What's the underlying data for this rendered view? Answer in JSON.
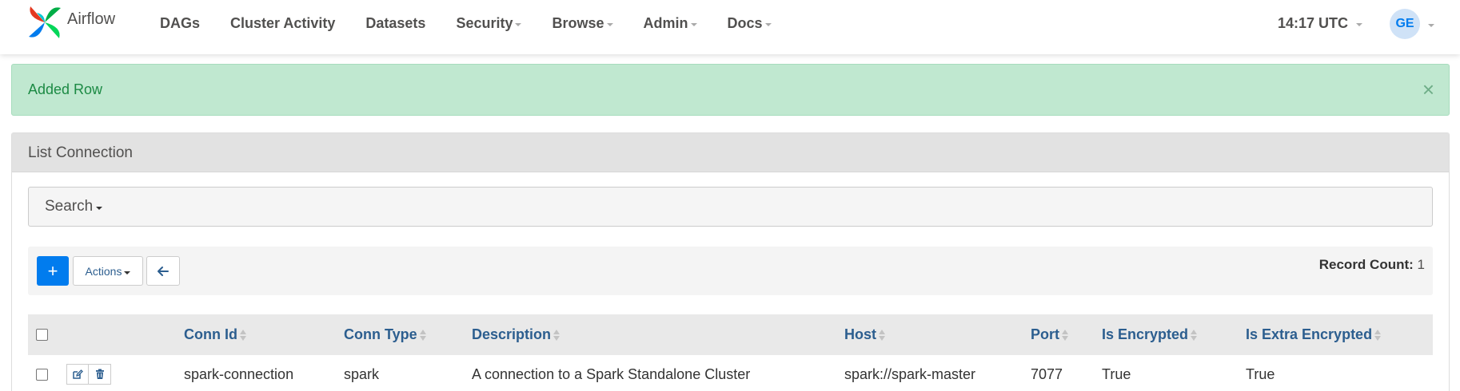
{
  "navbar": {
    "brand": "Airflow",
    "items": [
      {
        "label": "DAGs",
        "dropdown": false
      },
      {
        "label": "Cluster Activity",
        "dropdown": false
      },
      {
        "label": "Datasets",
        "dropdown": false
      },
      {
        "label": "Security",
        "dropdown": true
      },
      {
        "label": "Browse",
        "dropdown": true
      },
      {
        "label": "Admin",
        "dropdown": true
      },
      {
        "label": "Docs",
        "dropdown": true
      }
    ],
    "clock": "14:17 UTC",
    "user_initials": "GE"
  },
  "alert": {
    "message": "Added Row",
    "close": "×"
  },
  "panel": {
    "title": "List Connection",
    "search_label": "Search",
    "toolbar": {
      "add_label": "+",
      "actions_label": "Actions",
      "record_count_label": "Record Count:",
      "record_count_value": "1"
    },
    "table": {
      "columns": [
        "Conn Id",
        "Conn Type",
        "Description",
        "Host",
        "Port",
        "Is Encrypted",
        "Is Extra Encrypted"
      ],
      "rows": [
        {
          "conn_id": "spark-connection",
          "conn_type": "spark",
          "description": "A connection to a Spark Standalone Cluster",
          "host": "spark://spark-master",
          "port": "7077",
          "is_encrypted": "True",
          "is_extra_encrypted": "True"
        }
      ]
    }
  },
  "colors": {
    "accent": "#017cee",
    "link": "#2c5e8f",
    "alert_bg": "#c0e8d0",
    "alert_text": "#1c8a44"
  },
  "icons": [
    "airflow-pinwheel-logo",
    "caret-down-icon",
    "close-icon",
    "plus-icon",
    "arrow-left-icon",
    "sort-icon",
    "edit-icon",
    "trash-icon"
  ]
}
